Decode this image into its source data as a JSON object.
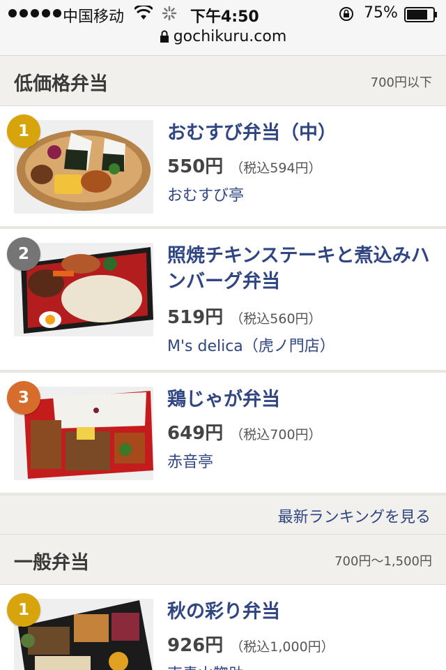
{
  "status_bar": {
    "carrier": "中国移动",
    "time": "下午4:50",
    "battery": "75%",
    "icons": [
      "signal-dots",
      "wifi-icon",
      "loading-spinner-icon",
      "rotation-lock-icon",
      "battery-icon"
    ]
  },
  "browser": {
    "url": "gochikuru.com",
    "icon": "lock-icon"
  },
  "sections": [
    {
      "title": "低価格弁当",
      "range": "700円以下",
      "items": [
        {
          "rank": "1",
          "name": "おむすび弁当（中）",
          "price": "550円",
          "tax": "（税込594円）",
          "shop": "おむすび亭"
        },
        {
          "rank": "2",
          "name": "照焼チキンステーキと煮込みハンバーグ弁当",
          "price": "519円",
          "tax": "（税込560円）",
          "shop": "M's delica（虎ノ門店）"
        },
        {
          "rank": "3",
          "name": "鶏じゃが弁当",
          "price": "649円",
          "tax": "（税込700円）",
          "shop": "赤音亭"
        }
      ],
      "more_label": "最新ランキングを見る"
    },
    {
      "title": "一般弁当",
      "range": "700円〜1,500円",
      "items": [
        {
          "rank": "1",
          "name": "秋の彩り弁当",
          "price": "926円",
          "tax": "（税込1,000円）",
          "shop": "東青山惣助"
        }
      ]
    }
  ],
  "colors": {
    "link": "#2f4683",
    "gold": "#d8a40b",
    "silver": "#757575",
    "bronze": "#d66d2c"
  }
}
